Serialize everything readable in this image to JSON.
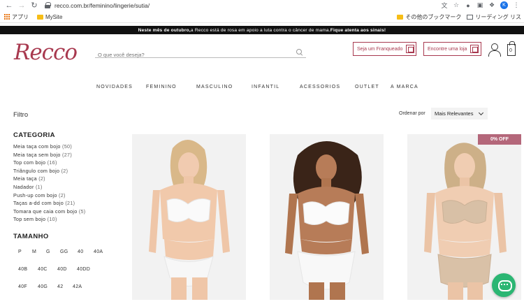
{
  "browser": {
    "url_host": "recco.com.br",
    "url_path": "/feminino/lingerie/sutia/",
    "profile_initial": "K",
    "bookmarks": [
      "アプリ",
      "MySite"
    ],
    "bookmarks_right": [
      "その他のブックマーク",
      "リーディング リス"
    ]
  },
  "promo": {
    "lead": "Neste mês de outubro,",
    "middle": " a Recco está de rosa em apoio a luta contra o câncer de mama. ",
    "cta": "Fique atenta aos sinais!"
  },
  "header": {
    "logo": "Recco",
    "search_placeholder": "O que você deseja?",
    "franchise_button": "Seja um Franqueado",
    "store_button": "Encontre uma loja",
    "bag_count": "0"
  },
  "nav": [
    "NOVIDADES",
    "FEMININO",
    "MASCULINO",
    "INFANTIL",
    "ACESSORIOS",
    "OUTLET",
    "A MARCA"
  ],
  "filter": {
    "label": "Filtro",
    "sort_label": "Ordenar por",
    "sort_value": "Mais Relevantes",
    "category_title": "CATEGORIA",
    "categories": [
      {
        "name": "Meia taça com bojo",
        "count": "(50)"
      },
      {
        "name": "Meia taça sem bojo",
        "count": "(27)"
      },
      {
        "name": "Top com bojo",
        "count": "(16)"
      },
      {
        "name": "Triângulo com bojo",
        "count": "(2)"
      },
      {
        "name": "Meia taça",
        "count": "(2)"
      },
      {
        "name": "Nadador",
        "count": "(1)"
      },
      {
        "name": "Push-up com bojo",
        "count": "(2)"
      },
      {
        "name": "Taças a-dd com bojo",
        "count": "(21)"
      },
      {
        "name": "Tomara que caia com bojo",
        "count": "(5)"
      },
      {
        "name": "Top sem bojo",
        "count": "(10)"
      }
    ],
    "size_title": "TAMANHO",
    "sizes": [
      "P",
      "M",
      "G",
      "GG",
      "40",
      "40A",
      "40B",
      "40C",
      "40D",
      "40DD",
      "40F",
      "40G",
      "42",
      "42A"
    ]
  },
  "products": {
    "badge": "0% OFF"
  },
  "colors": {
    "brand": "#a8394f",
    "badge": "#b4677a",
    "chat": "#2bb673"
  }
}
